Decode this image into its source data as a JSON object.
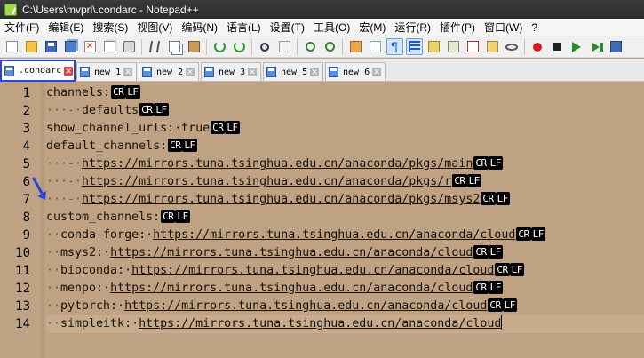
{
  "window": {
    "title": "C:\\Users\\mvpri\\.condarc - Notepad++"
  },
  "menubar": {
    "items": [
      "文件(F)",
      "编辑(E)",
      "搜索(S)",
      "视图(V)",
      "编码(N)",
      "语言(L)",
      "设置(T)",
      "工具(O)",
      "宏(M)",
      "运行(R)",
      "插件(P)",
      "窗口(W)",
      "?"
    ]
  },
  "toolbar": {
    "icons": [
      "new-file-icon",
      "open-file-icon",
      "save-icon",
      "save-all-icon",
      "close-icon",
      "close-all-icon",
      "print-icon",
      "cut-icon",
      "copy-icon",
      "paste-icon",
      "undo-icon",
      "redo-icon",
      "find-icon",
      "replace-icon",
      "zoom-in-icon",
      "zoom-out-icon",
      "sync-scroll-icon",
      "word-wrap-icon",
      "show-all-chars-icon",
      "indent-guide-icon",
      "user-language-icon",
      "document-map-icon",
      "function-list-icon",
      "folder-workspace-icon",
      "monitoring-icon",
      "record-macro-icon",
      "stop-macro-icon",
      "play-macro-icon",
      "run-macro-multiple-icon",
      "save-macro-icon"
    ]
  },
  "tabs": [
    {
      "label": ".condarc",
      "active": true
    },
    {
      "label": "new 1",
      "active": false
    },
    {
      "label": "new 2",
      "active": false
    },
    {
      "label": "new 3",
      "active": false
    },
    {
      "label": "new 5",
      "active": false
    },
    {
      "label": "new 6",
      "active": false
    }
  ],
  "editor": {
    "theme_background": "#bfa283",
    "eol_markers": {
      "cr": "CR",
      "lf": "LF"
    },
    "lines": [
      {
        "number": "1",
        "ws": "",
        "text": "channels:",
        "url": "",
        "eol": true
      },
      {
        "number": "2",
        "ws": "···-·",
        "text": "defaults",
        "url": "",
        "eol": true
      },
      {
        "number": "3",
        "ws": "",
        "text": "show_channel_urls:·true",
        "url": "",
        "eol": true
      },
      {
        "number": "4",
        "ws": "",
        "text": "default_channels:",
        "url": "",
        "eol": true
      },
      {
        "number": "5",
        "ws": "···-·",
        "text": "",
        "url": "https://mirrors.tuna.tsinghua.edu.cn/anaconda/pkgs/main",
        "eol": true
      },
      {
        "number": "6",
        "ws": "···-·",
        "text": "",
        "url": "https://mirrors.tuna.tsinghua.edu.cn/anaconda/pkgs/r",
        "eol": true
      },
      {
        "number": "7",
        "ws": "···-·",
        "text": "",
        "url": "https://mirrors.tuna.tsinghua.edu.cn/anaconda/pkgs/msys2",
        "eol": true
      },
      {
        "number": "8",
        "ws": "",
        "text": "custom_channels:",
        "url": "",
        "eol": true
      },
      {
        "number": "9",
        "ws": "··",
        "text": "conda-forge:·",
        "url": "https://mirrors.tuna.tsinghua.edu.cn/anaconda/cloud",
        "eol": true
      },
      {
        "number": "10",
        "ws": "··",
        "text": "msys2:·",
        "url": "https://mirrors.tuna.tsinghua.edu.cn/anaconda/cloud",
        "eol": true
      },
      {
        "number": "11",
        "ws": "··",
        "text": "bioconda:·",
        "url": "https://mirrors.tuna.tsinghua.edu.cn/anaconda/cloud",
        "eol": true
      },
      {
        "number": "12",
        "ws": "··",
        "text": "menpo:·",
        "url": "https://mirrors.tuna.tsinghua.edu.cn/anaconda/cloud",
        "eol": true
      },
      {
        "number": "13",
        "ws": "··",
        "text": "pytorch:·",
        "url": "https://mirrors.tuna.tsinghua.edu.cn/anaconda/cloud",
        "eol": true
      },
      {
        "number": "14",
        "ws": "··",
        "text": "simpleitk:·",
        "url": "https://mirrors.tuna.tsinghua.edu.cn/anaconda/cloud",
        "eol": false
      }
    ],
    "current_line": "14"
  },
  "colors": {
    "active_tab_border": "#2a46d8",
    "annotation_arrow": "#2a46d8",
    "close_active": "#e34040"
  }
}
